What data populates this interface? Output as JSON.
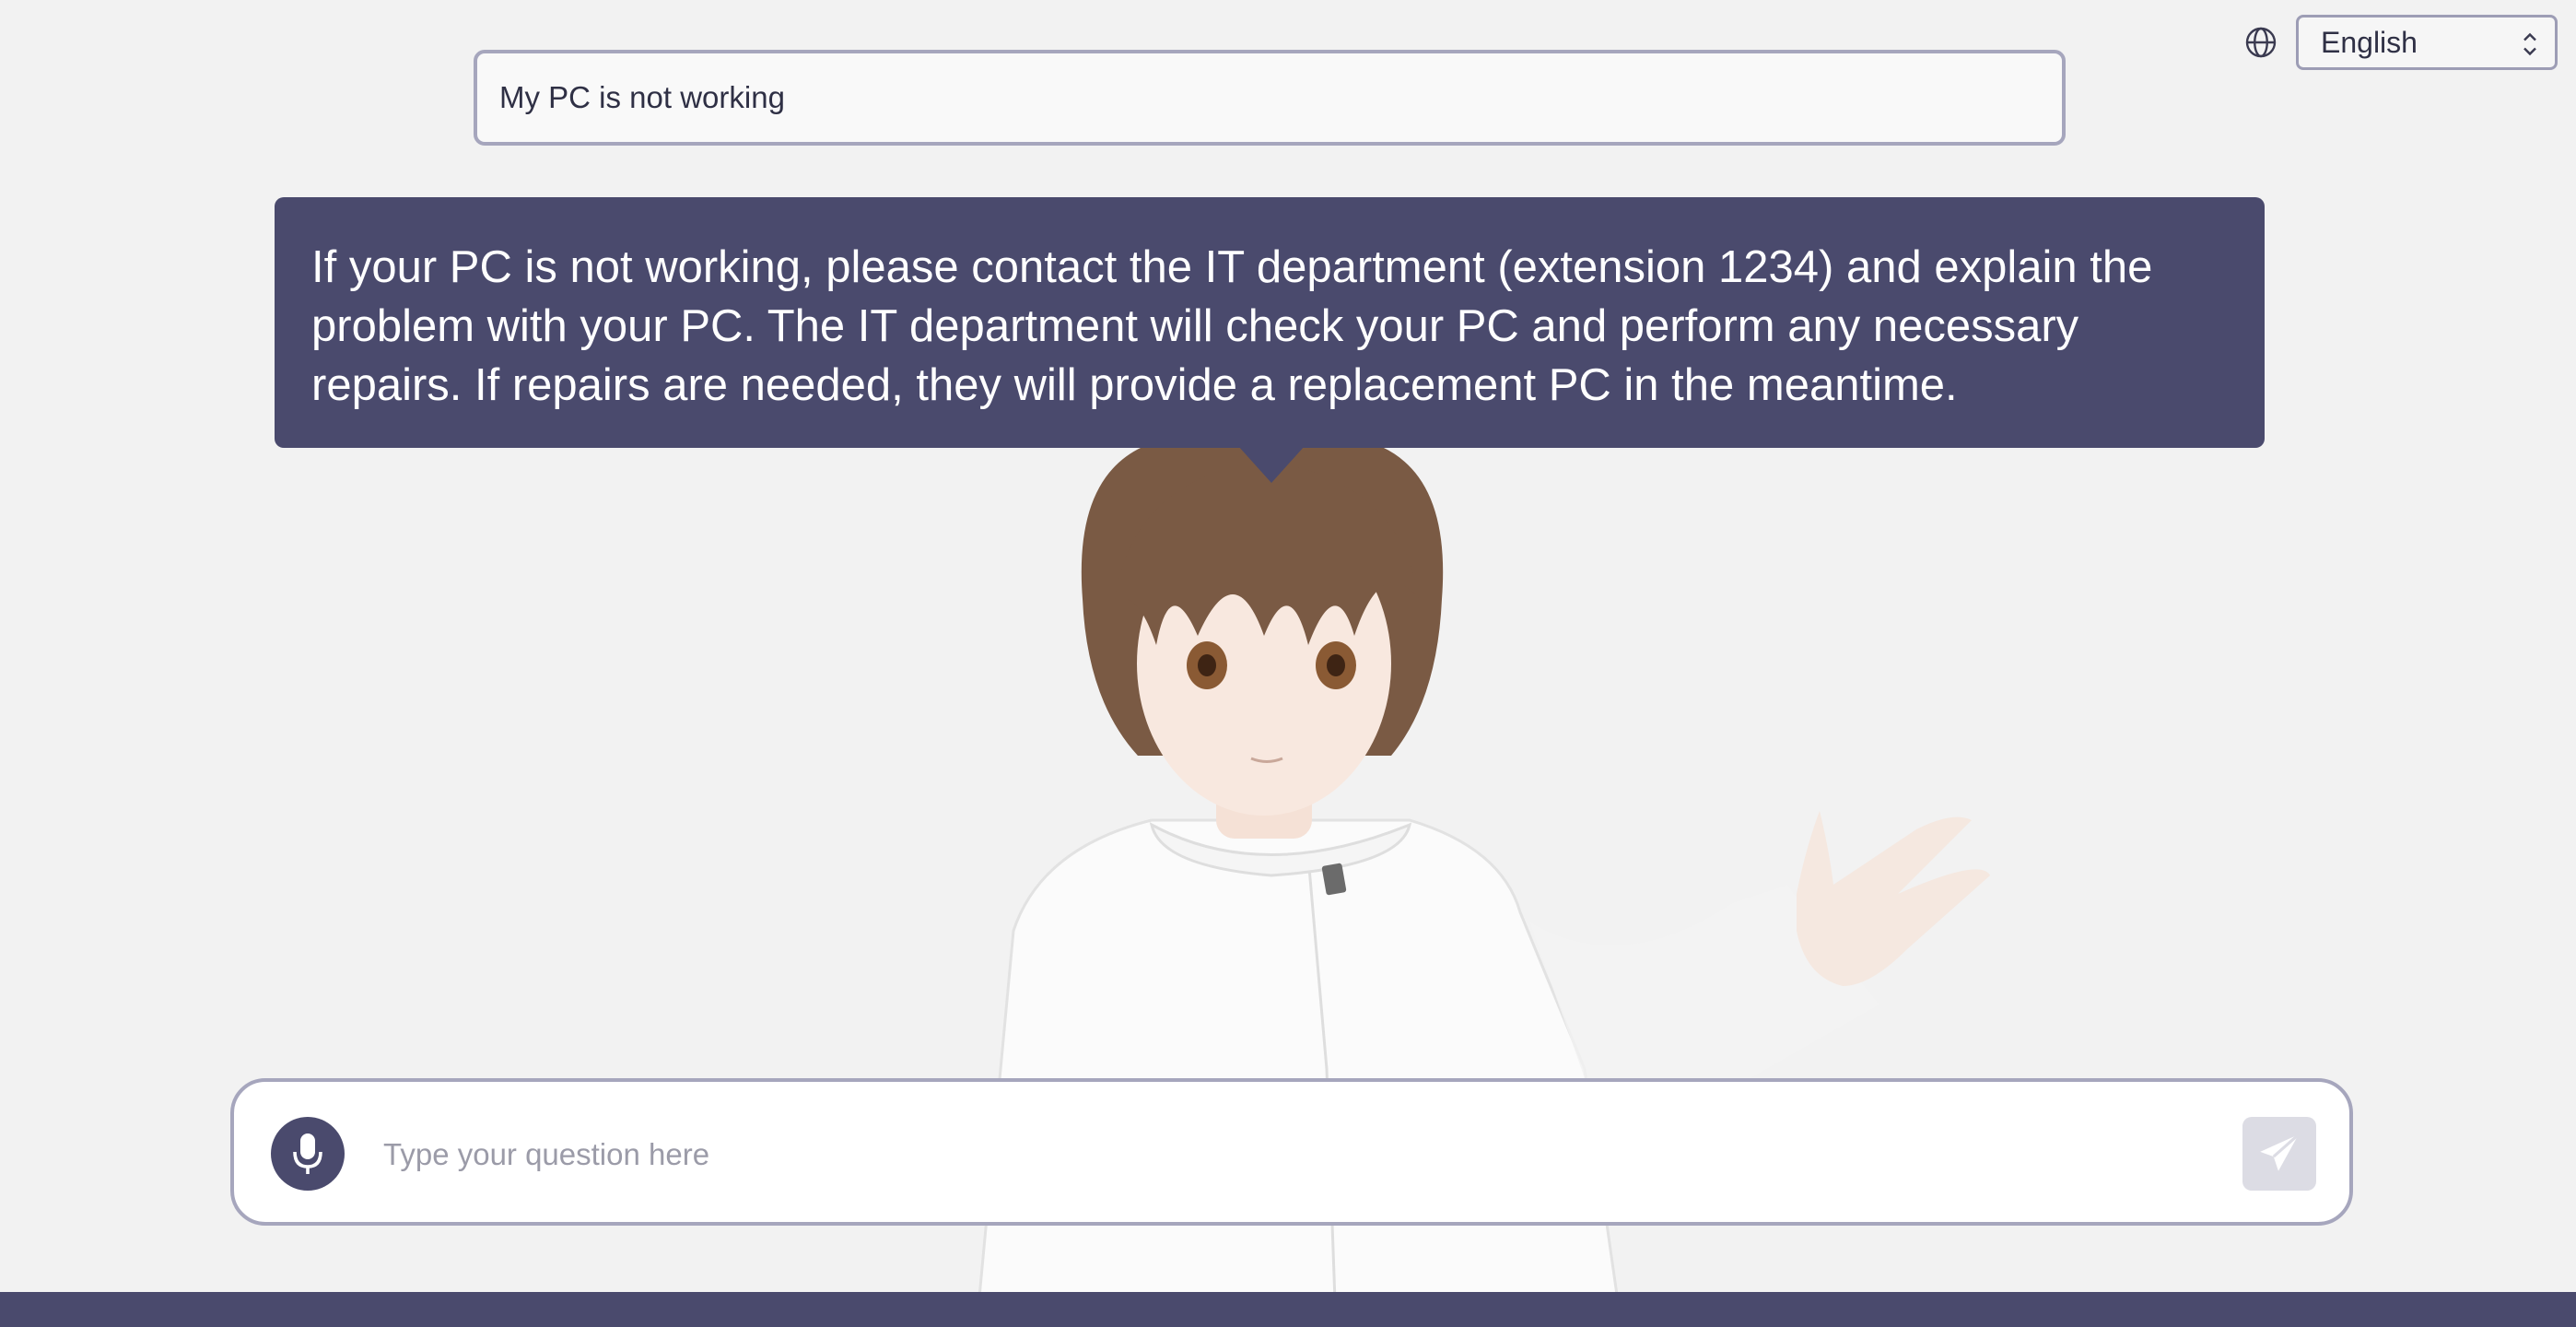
{
  "language": {
    "icon": "globe-icon",
    "selected": "English"
  },
  "question": {
    "text": "My PC is not working"
  },
  "answer": {
    "text": "If your PC is not working, please contact the IT department (extension 1234) and explain the problem with your PC. The IT department will check your PC and perform any necessary repairs. If repairs are needed, they will provide a replacement PC in the meantime."
  },
  "chat": {
    "placeholder": "Type your question here",
    "mic_icon": "microphone-icon",
    "send_icon": "paper-plane-icon"
  },
  "colors": {
    "accent": "#4a4a6d",
    "background": "#f2f2f2",
    "border": "#a6a6bd"
  }
}
